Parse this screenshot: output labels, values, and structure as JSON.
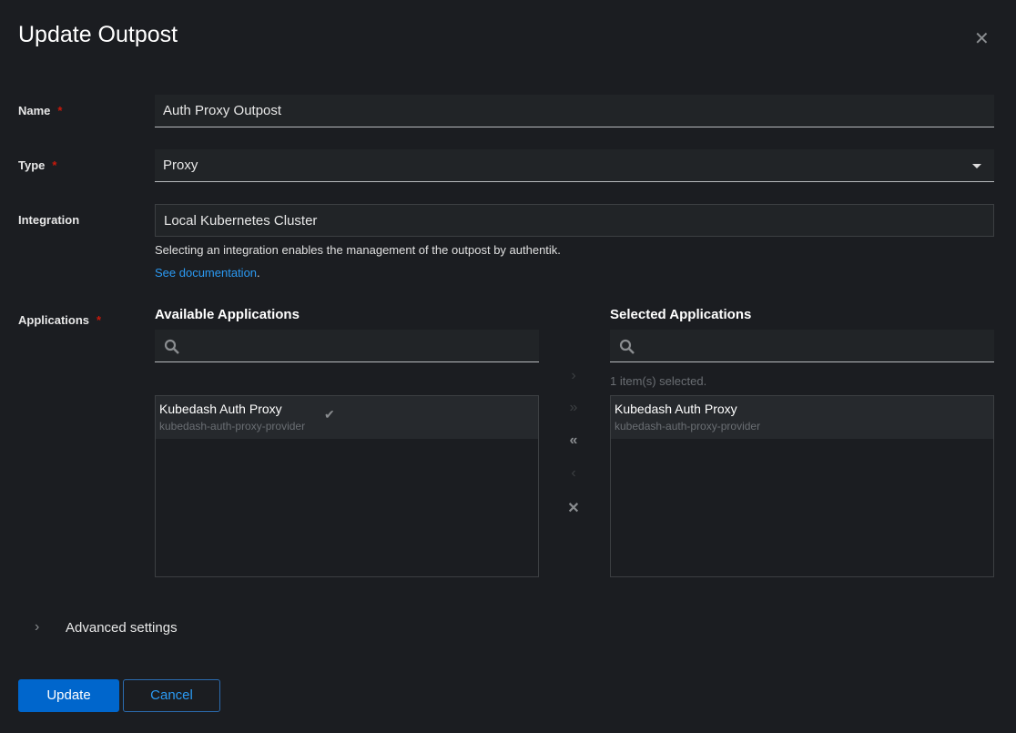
{
  "modal": {
    "title": "Update Outpost",
    "close_icon": "close-icon"
  },
  "form": {
    "name": {
      "label": "Name",
      "required": "*",
      "value": "Auth Proxy Outpost"
    },
    "type": {
      "label": "Type",
      "required": "*",
      "value": "Proxy"
    },
    "integration": {
      "label": "Integration",
      "value": "Local Kubernetes Cluster",
      "help": "Selecting an integration enables the management of the outpost by authentik.",
      "link": "See documentation",
      "link_suffix": "."
    },
    "applications": {
      "label": "Applications",
      "required": "*",
      "available": {
        "title": "Available Applications",
        "items": [
          {
            "name": "Kubedash Auth Proxy",
            "slug": "kubedash-auth-proxy-provider"
          }
        ]
      },
      "selected": {
        "title": "Selected Applications",
        "status": "1 item(s) selected.",
        "items": [
          {
            "name": "Kubedash Auth Proxy",
            "slug": "kubedash-auth-proxy-provider"
          }
        ]
      },
      "controls": {
        "add": "›",
        "add_all": "»",
        "remove_all": "«",
        "remove": "‹",
        "clear": "✕"
      }
    }
  },
  "advanced": {
    "label": "Advanced settings"
  },
  "footer": {
    "update": "Update",
    "cancel": "Cancel"
  },
  "colors": {
    "primary": "#0066cc",
    "link": "#2b9af3",
    "required": "#c9190b",
    "background": "#1b1d21"
  }
}
